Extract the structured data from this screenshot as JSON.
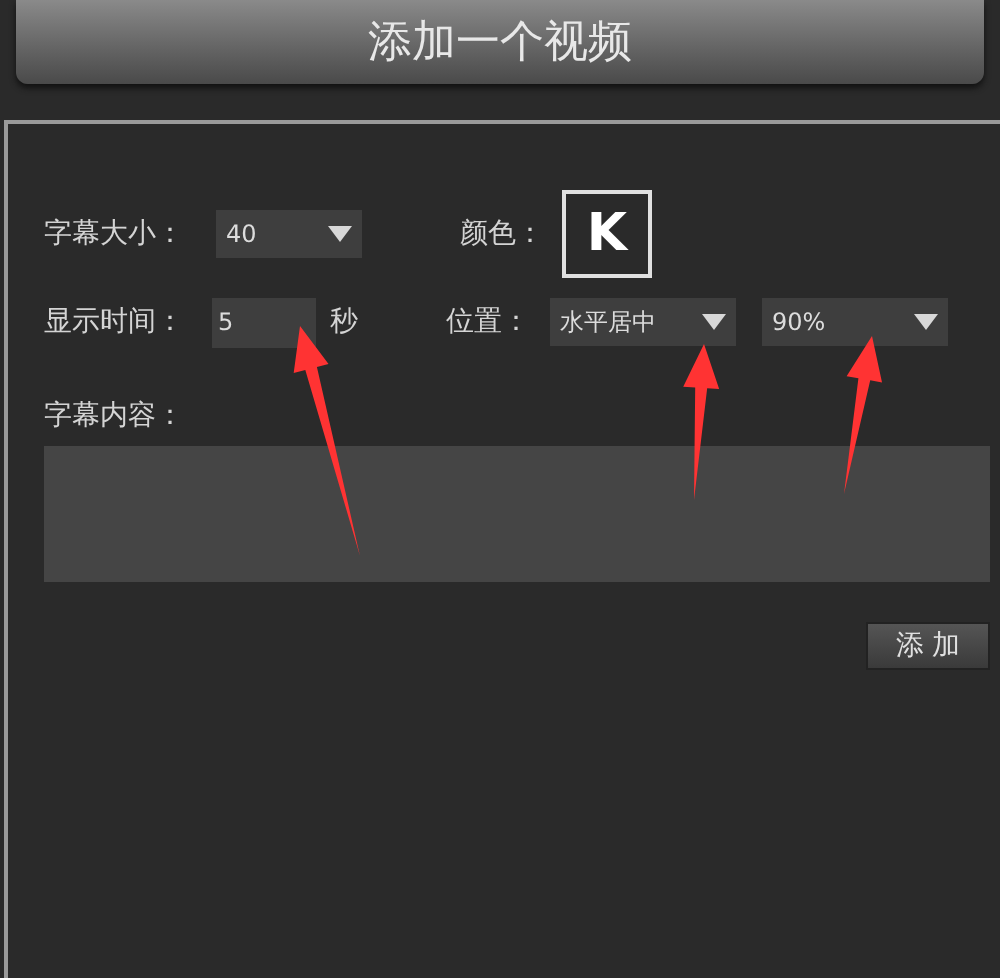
{
  "header": {
    "title": "添加一个视频"
  },
  "subtitle_size": {
    "label": "字幕大小：",
    "value": "40"
  },
  "color": {
    "label": "颜色：",
    "key": "K"
  },
  "duration": {
    "label": "显示时间：",
    "value": "5",
    "unit": "秒"
  },
  "position": {
    "label": "位置：",
    "horizontal": "水平居中",
    "vertical": "90%"
  },
  "content": {
    "label": "字幕内容："
  },
  "add_button": {
    "label": "添 加"
  }
}
